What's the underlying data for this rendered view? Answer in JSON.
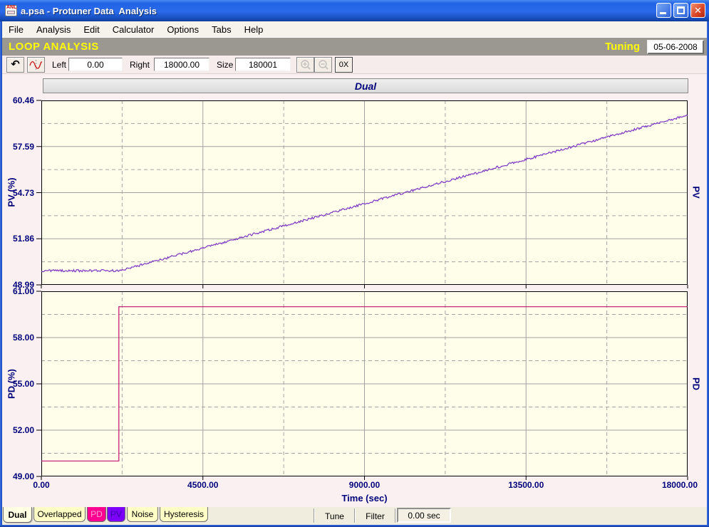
{
  "window": {
    "title": "a.psa - Protuner Data  Analysis",
    "icon_label": "ANL"
  },
  "menu": {
    "items": [
      "File",
      "Analysis",
      "Edit",
      "Calculator",
      "Options",
      "Tabs",
      "Help"
    ]
  },
  "header": {
    "title": "LOOP ANALYSIS",
    "mode": "Tuning",
    "date": "05-06-2008"
  },
  "toolbar": {
    "left_label": "Left",
    "left_value": "0.00",
    "right_label": "Right",
    "right_value": "18000.00",
    "size_label": "Size",
    "size_value": "180001",
    "reset_zoom_label": "0X",
    "icons": [
      "undo-arrow-icon",
      "trend-curve-icon",
      "zoom-in-icon",
      "zoom-out-icon"
    ]
  },
  "chart_title": "Dual",
  "chart_data": [
    {
      "type": "line",
      "name": "PV",
      "ylabel_left": "PV (%)",
      "ylabel_right": "PV",
      "ytick_labels": [
        "60.46",
        "57.59",
        "54.73",
        "51.86",
        "48.99"
      ],
      "ylim": [
        48.99,
        60.46
      ],
      "xlim": [
        0,
        18000
      ],
      "xticks": [
        0,
        4500,
        9000,
        13500,
        18000
      ],
      "grid": "solid majors with dashed midlines",
      "series": [
        {
          "name": "PV",
          "color": "#7D35C3",
          "points": [
            [
              0,
              49.87
            ],
            [
              2200,
              49.87
            ],
            [
              18000,
              59.55
            ]
          ],
          "noise_amplitude": 0.07,
          "description": "flat noisy baseline ~49.9% until t=2200s, then noisy linear ramp to ~59.55% at 18000s"
        }
      ]
    },
    {
      "type": "line",
      "name": "PD",
      "ylabel_left": "PD (%)",
      "ylabel_right": "PD",
      "ytick_labels": [
        "61.00",
        "58.00",
        "55.00",
        "52.00",
        "49.00"
      ],
      "ylim": [
        49.0,
        61.0
      ],
      "xlim": [
        0,
        18000
      ],
      "xticks": [
        0,
        4500,
        9000,
        13500,
        18000
      ],
      "xtick_labels": [
        "0.00",
        "4500.00",
        "9000.00",
        "13500.00",
        "18000.00"
      ],
      "xlabel": "Time (sec)",
      "grid": "solid majors with dashed midlines",
      "series": [
        {
          "name": "PD",
          "color": "#C2106E",
          "points": [
            [
              0,
              50.0
            ],
            [
              2160,
              50.0
            ],
            [
              2160,
              60.0
            ],
            [
              18000,
              60.0
            ]
          ],
          "noise_amplitude": 0,
          "description": "step output: 50.00% until t=2160s, steps to 60.00% and holds to 18000s"
        }
      ]
    }
  ],
  "bottom_bar": {
    "tabs": [
      {
        "label": "Dual",
        "active": true,
        "bg": "#FFFFE4",
        "fg": "#000000"
      },
      {
        "label": "Overlapped",
        "active": false,
        "bg": "#FFFFC6",
        "fg": "#000000"
      },
      {
        "label": "PD",
        "active": false,
        "bg": "#FF0090",
        "fg": "#FF9FD0"
      },
      {
        "label": "PV",
        "active": false,
        "bg": "#7C00FA",
        "fg": "#3A0AA8"
      },
      {
        "label": "Noise",
        "active": false,
        "bg": "#FFFFC6",
        "fg": "#000000"
      },
      {
        "label": "Hysteresis",
        "active": false,
        "bg": "#FFFFC6",
        "fg": "#000000"
      }
    ],
    "buttons": [
      "Tune",
      "Filter"
    ],
    "filter_value": "0.00 sec"
  },
  "colors": {
    "axis_navy": "#00007B",
    "plot_bg": "#FFFEEA",
    "panel_pink": "#FAF0F2",
    "header_gray": "#9A9890",
    "title_yellow": "#FFFF00",
    "pv_line": "#7D35C3",
    "pd_line": "#C2106E"
  }
}
